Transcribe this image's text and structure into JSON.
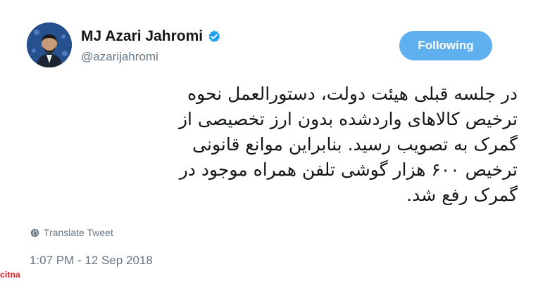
{
  "user": {
    "display_name": "MJ Azari Jahromi",
    "handle": "@azarijahromi",
    "avatar_icon": "profile-avatar",
    "verified_icon": "verified-badge-icon",
    "verified_color": "#1da1f2"
  },
  "actions": {
    "follow_label": "Following",
    "follow_color": "#5fb0ee"
  },
  "tweet": {
    "lines": [
      "در جلسه قبلی هیئت دولت، دستورالعمل نحوه",
      "ترخیص کالاهای واردشده بدون ارز تخصیصی از",
      "گمرک به تصویب رسید. بنابراین موانع قانونی",
      "ترخیص ۶۰۰ هزار گوشی تلفن همراه موجود در",
      "گمرک رفع شد."
    ],
    "translate_label": "Translate Tweet",
    "translate_icon": "globe-icon",
    "timestamp": "1:07 PM - 12 Sep 2018"
  },
  "watermark": {
    "text": "citna"
  }
}
